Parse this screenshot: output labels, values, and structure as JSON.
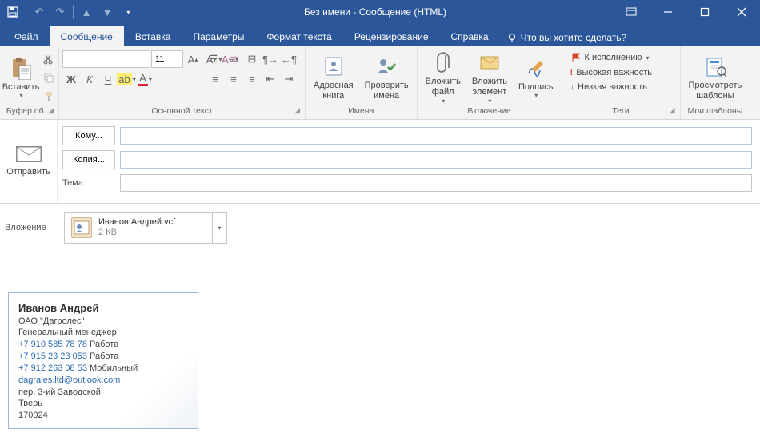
{
  "window": {
    "title": "Без имени  -  Сообщение (HTML)"
  },
  "tabs": {
    "file": "Файл",
    "message": "Сообщение",
    "insert": "Вставка",
    "options": "Параметры",
    "format": "Формат текста",
    "review": "Рецензирование",
    "help": "Справка",
    "tell_me": "Что вы хотите сделать?"
  },
  "ribbon": {
    "clipboard": {
      "paste": "Вставить",
      "group_label": "Буфер об…"
    },
    "basic_text": {
      "font_name": "",
      "font_size": "11",
      "bold": "Ж",
      "italic": "К",
      "underline": "Ч",
      "group_label": "Основной текст"
    },
    "names": {
      "address_book": "Адресная\nкнига",
      "check_names": "Проверить\nимена",
      "group_label": "Имена"
    },
    "include": {
      "attach_file": "Вложить\nфайл",
      "attach_item": "Вложить\nэлемент",
      "signature": "Подпись",
      "group_label": "Включение"
    },
    "tags": {
      "follow_up": "К исполнению",
      "high": "Высокая важность",
      "low": "Низкая важность",
      "group_label": "Теги"
    },
    "templates": {
      "view_templates": "Просмотреть\nшаблоны",
      "group_label": "Мои шаблоны"
    }
  },
  "compose": {
    "send": "Отправить",
    "to_label": "Кому...",
    "cc_label": "Копия...",
    "subject_label": "Тема",
    "to_value": "",
    "cc_value": "",
    "subject_value": "",
    "attach_label": "Вложение",
    "attachment": {
      "name": "Иванов Андрей.vcf",
      "size": "2 КВ"
    }
  },
  "vcard": {
    "name": "Иванов Андрей",
    "company": "ОАО \"Дагролес\"",
    "title": "Генеральный менеджер",
    "phone1": "+7 910 585 78 78",
    "phone1_type": "Работа",
    "phone2": "+7 915 23 23 053",
    "phone2_type": "Работа",
    "phone3": "+7 912 263 08 53",
    "phone3_type": "Мобильный",
    "email": "dagrales.ltd@outlook.com",
    "addr1": "пер. 3-ий Заводской",
    "city": "Тверь",
    "zip": "170024"
  }
}
